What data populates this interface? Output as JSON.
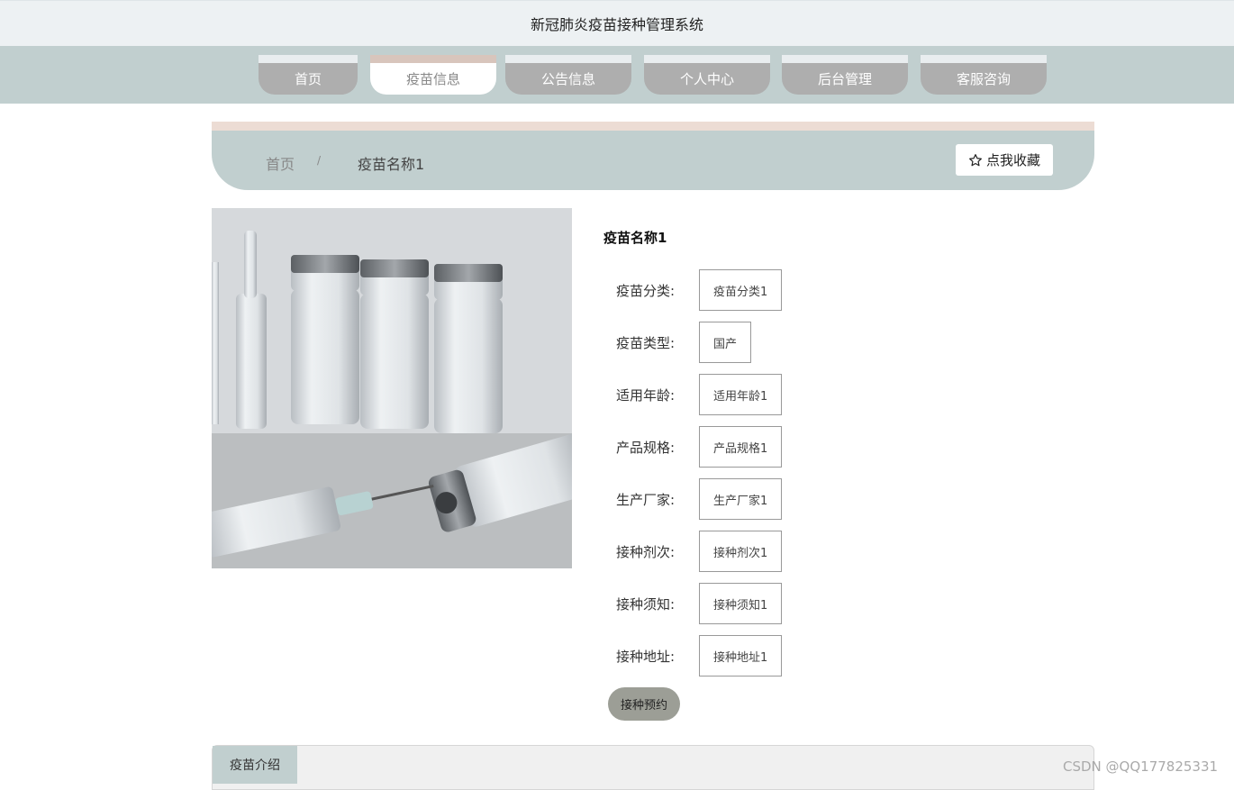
{
  "header": {
    "title": "新冠肺炎疫苗接种管理系统"
  },
  "nav": {
    "items": [
      {
        "label": "首页",
        "active": false
      },
      {
        "label": "疫苗信息",
        "active": true
      },
      {
        "label": "公告信息",
        "active": false
      },
      {
        "label": "个人中心",
        "active": false
      },
      {
        "label": "后台管理",
        "active": false
      },
      {
        "label": "客服咨询",
        "active": false
      }
    ]
  },
  "breadcrumb": {
    "home": "首页",
    "separator": "/",
    "current": "疫苗名称1"
  },
  "favorite": {
    "icon": "star-outline-icon",
    "label": "点我收藏"
  },
  "product": {
    "name": "疫苗名称1",
    "fields": [
      {
        "label": "疫苗分类:",
        "value": "疫苗分类1"
      },
      {
        "label": "疫苗类型:",
        "value": "国产"
      },
      {
        "label": "适用年龄:",
        "value": "适用年龄1"
      },
      {
        "label": "产品规格:",
        "value": "产品规格1"
      },
      {
        "label": "生产厂家:",
        "value": "生产厂家1"
      },
      {
        "label": "接种剂次:",
        "value": "接种剂次1"
      },
      {
        "label": "接种须知:",
        "value": "接种须知1"
      },
      {
        "label": "接种地址:",
        "value": "接种地址1"
      }
    ],
    "book_label": "接种预约"
  },
  "tabs": {
    "intro": "疫苗介绍"
  },
  "watermark": "CSDN @QQ177825331",
  "colors": {
    "band": "#c1cfcf",
    "nav_inactive": "#aeaeae",
    "accent_top": "#ecdcd4",
    "book_button": "#9c9e96"
  }
}
